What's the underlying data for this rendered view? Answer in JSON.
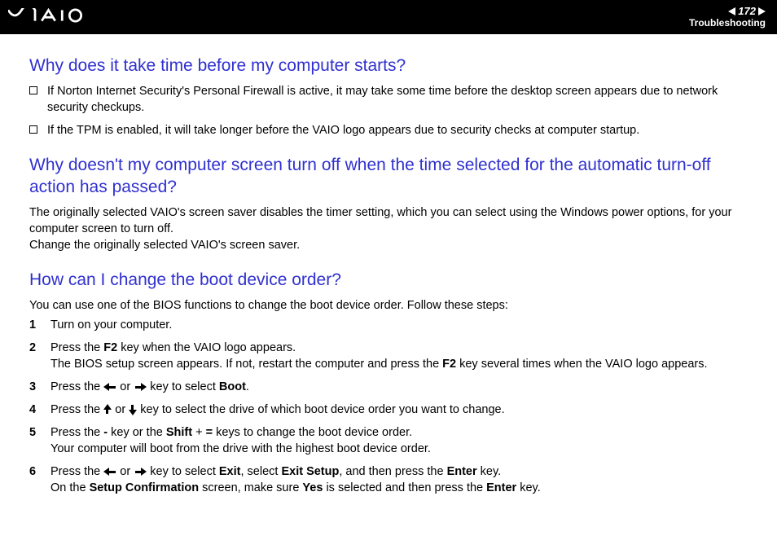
{
  "header": {
    "page_number": "172",
    "section": "Troubleshooting"
  },
  "q1": {
    "heading": "Why does it take time before my computer starts?",
    "bullets": [
      "If Norton Internet Security's Personal Firewall is active, it may take some time before the desktop screen appears due to network security checkups.",
      "If the TPM is enabled, it will take longer before the VAIO logo appears due to security checks at computer startup."
    ]
  },
  "q2": {
    "heading": "Why doesn't my computer screen turn off when the time selected for the automatic turn-off action has passed?",
    "para1": "The originally selected VAIO's screen saver disables the timer setting, which you can select using the Windows power options, for your computer screen to turn off.",
    "para2": "Change the originally selected VAIO's screen saver."
  },
  "q3": {
    "heading": "How can I change the boot device order?",
    "intro": "You can use one of the BIOS functions to change the boot device order. Follow these steps:",
    "steps": {
      "s1": "Turn on your computer.",
      "s2a": "Press the ",
      "s2b": " key when the VAIO logo appears.",
      "s2c": "The BIOS setup screen appears. If not, restart the computer and press the ",
      "s2d": " key several times when the VAIO logo appears.",
      "k_f2": "F2",
      "s3a": "Press the ",
      "s3b": " or ",
      "s3c": " key to select ",
      "k_boot": "Boot",
      "s4a": "Press the ",
      "s4b": " or ",
      "s4c": " key to select the drive of which boot device order you want to change.",
      "s5a": "Press the ",
      "k_minus": "-",
      "s5b": " key or the ",
      "k_shift": "Shift",
      "s5c": " + ",
      "k_eq": "=",
      "s5d": " keys to change the boot device order.",
      "s5e": "Your computer will boot from the drive with the highest boot device order.",
      "s6a": "Press the ",
      "s6b": " or ",
      "s6c": " key to select ",
      "k_exit": "Exit",
      "s6d": ", select ",
      "k_exitsetup": "Exit Setup",
      "s6e": ", and then press the ",
      "k_enter": "Enter",
      "s6f": " key.",
      "s6g": "On the ",
      "k_setupconf": "Setup Confirmation",
      "s6h": " screen, make sure ",
      "k_yes": "Yes",
      "s6i": " is selected and then press the ",
      "s6j": " key."
    }
  }
}
